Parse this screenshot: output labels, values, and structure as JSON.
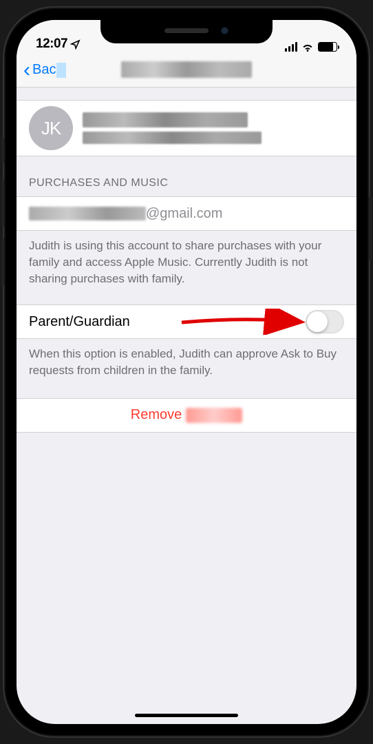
{
  "statusBar": {
    "time": "12:07"
  },
  "nav": {
    "backLabel": "Bac"
  },
  "profile": {
    "initials": "JK"
  },
  "sections": {
    "purchasesHeader": "PURCHASES AND MUSIC",
    "emailSuffix": "@gmail.com",
    "purchasesFooter": "Judith is using this account to share purchases with your family and access Apple Music. Currently Judith is not sharing purchases with family.",
    "parentGuardianLabel": "Parent/Guardian",
    "parentGuardianOn": false,
    "parentGuardianFooter": "When this option is enabled, Judith can approve Ask to Buy requests from children in the family.",
    "removeLabel": "Remove"
  }
}
